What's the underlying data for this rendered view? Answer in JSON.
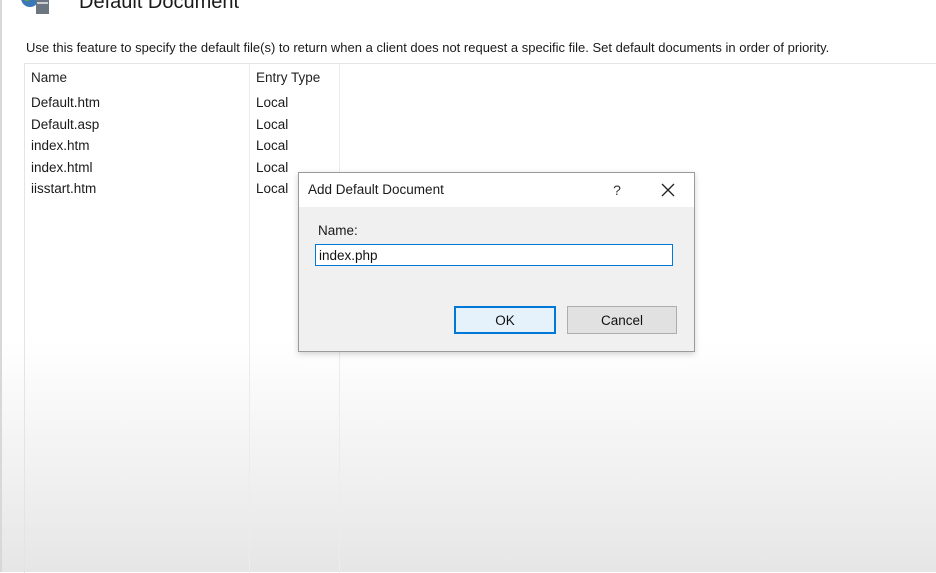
{
  "header": {
    "title": "Default Document",
    "description": "Use this feature to specify the default file(s) to return when a client does not request a specific file. Set default documents in order of priority."
  },
  "list": {
    "columns": [
      "Name",
      "Entry Type"
    ],
    "rows": [
      {
        "name": "Default.htm",
        "entry_type": "Local"
      },
      {
        "name": "Default.asp",
        "entry_type": "Local"
      },
      {
        "name": "index.htm",
        "entry_type": "Local"
      },
      {
        "name": "index.html",
        "entry_type": "Local"
      },
      {
        "name": "iisstart.htm",
        "entry_type": "Local"
      }
    ]
  },
  "dialog": {
    "title": "Add Default Document",
    "help_symbol": "?",
    "name_label": "Name:",
    "name_value": "index.php",
    "ok_label": "OK",
    "cancel_label": "Cancel"
  },
  "icons": {
    "feature": "iis-server-globe-icon",
    "close": "close-icon"
  },
  "colors": {
    "focus_accent": "#0078d7",
    "dialog_background": "#f0f0f0"
  }
}
